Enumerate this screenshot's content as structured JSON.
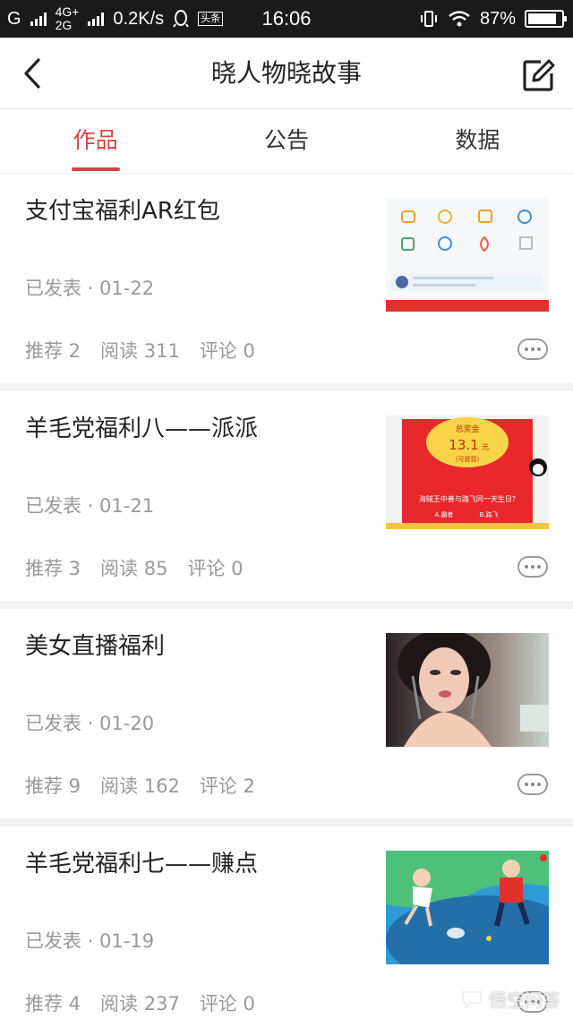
{
  "status_bar": {
    "carrier1": "G",
    "net_top": "4G+",
    "net_bottom": "2G",
    "speed": "0.2K/s",
    "app_badge": "头条",
    "time": "16:06",
    "battery": "87%",
    "battery_level": 0.87
  },
  "navbar": {
    "title": "晓人物晓故事"
  },
  "tabs": [
    {
      "label": "作品",
      "active": true
    },
    {
      "label": "公告",
      "active": false
    },
    {
      "label": "数据",
      "active": false
    }
  ],
  "articles": [
    {
      "title": "支付宝福利AR红包",
      "status": "已发表",
      "date": "01-22",
      "recommend_label": "推荐 2",
      "read_label": "阅读 311",
      "comment_label": "评论 0"
    },
    {
      "title": "羊毛党福利八——派派",
      "status": "已发表",
      "date": "01-21",
      "recommend_label": "推荐 3",
      "read_label": "阅读 85",
      "comment_label": "评论 0",
      "thumb_text": {
        "top": "总奖金",
        "amount": "13.1",
        "unit": "元",
        "sub": "(可提现)",
        "question": "海贼王中善与路飞同一天生日?",
        "opt_a": "A.霸者",
        "opt_b": "B.路飞"
      }
    },
    {
      "title": "美女直播福利",
      "status": "已发表",
      "date": "01-20",
      "recommend_label": "推荐 9",
      "read_label": "阅读 162",
      "comment_label": "评论 2"
    },
    {
      "title": "羊毛党福利七——赚点",
      "status": "已发表",
      "date": "01-19",
      "recommend_label": "推荐 4",
      "read_label": "阅读 237",
      "comment_label": "评论 0"
    }
  ],
  "watermark": "悟空问答",
  "colors": {
    "accent": "#d64541",
    "meta_text": "#999999",
    "divider": "#f2f2f2"
  }
}
